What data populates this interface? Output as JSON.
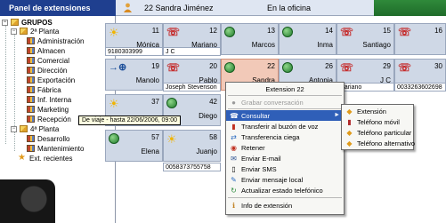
{
  "header": {
    "panel_title": "Panel de extensiones",
    "agent_ext": "22  Sandra Jiménez",
    "agent_status": "En la oficina"
  },
  "tree": {
    "root": "GRUPOS",
    "items": [
      {
        "label": "2ª Planta"
      },
      {
        "label": "Administración"
      },
      {
        "label": "Almacen"
      },
      {
        "label": "Comercial"
      },
      {
        "label": "Dirección"
      },
      {
        "label": "Exportación"
      },
      {
        "label": "Fábrica"
      },
      {
        "label": "Inf. Interna"
      },
      {
        "label": "Marketing"
      },
      {
        "label": "Recepción"
      },
      {
        "label": "4ª Planta"
      },
      {
        "label": "Desarrollo"
      },
      {
        "label": "Mantenimiento"
      },
      {
        "label": "Ext. recientes"
      }
    ]
  },
  "tooltip": "De viaje - hasta 22/06/2006, 09:00",
  "extensions": [
    {
      "num": "11",
      "name": "Mónica",
      "icon": "sun-icon"
    },
    {
      "num": "12",
      "name": "Mariano",
      "icon": "phone-icon"
    },
    {
      "num": "13",
      "name": "Marcos",
      "icon": "available-icon"
    },
    {
      "num": "14",
      "name": "Inma",
      "icon": "available-icon"
    },
    {
      "num": "15",
      "name": "Santiago",
      "icon": "phone-icon"
    },
    {
      "num": "16",
      "name": "",
      "icon": "phone-icon"
    },
    {
      "num": "19",
      "name": "Manolo",
      "icon": "redirect-icon"
    },
    {
      "num": "20",
      "name": "Pablo",
      "icon": "phone-icon"
    },
    {
      "num": "22",
      "name": "Sandra",
      "icon": "available-icon"
    },
    {
      "num": "26",
      "name": "Antonia",
      "icon": "available-icon"
    },
    {
      "num": "29",
      "name": "J C",
      "icon": "phone-icon"
    },
    {
      "num": "30",
      "name": "",
      "icon": "phone-icon"
    },
    {
      "num": "37",
      "name": "",
      "icon": "sun-icon"
    },
    {
      "num": "42",
      "name": "Diego",
      "icon": "available-icon"
    },
    {
      "num": "57",
      "name": "Elena",
      "icon": "available-icon"
    },
    {
      "num": "58",
      "name": "Juanjo",
      "icon": "sun-icon"
    }
  ],
  "info_strips": {
    "r1c1": "9180303999",
    "r1c2": "J C",
    "r2c2": "Joseph Stevenson",
    "r2c5": "Mariano",
    "r2c6": "0033263602698",
    "r4c2": "0058373755758"
  },
  "context_menu": {
    "title": "Extension 22",
    "items": [
      {
        "label": "Grabar conversación",
        "icon": "record-icon",
        "enabled": false
      },
      {
        "label": "Consultar",
        "icon": "consult-icon",
        "enabled": true,
        "submenu": true,
        "highlighted": true
      },
      {
        "label": "Transferir al buzón de voz",
        "icon": "voicemail-icon",
        "enabled": true
      },
      {
        "label": "Transferencia ciega",
        "icon": "transfer-icon",
        "enabled": true
      },
      {
        "label": "Retener",
        "icon": "hold-icon",
        "enabled": true
      },
      {
        "label": "Enviar E-mail",
        "icon": "email-icon",
        "enabled": true
      },
      {
        "label": "Enviar SMS",
        "icon": "sms-icon",
        "enabled": true
      },
      {
        "label": "Enviar mensaje local",
        "icon": "message-icon",
        "enabled": true
      },
      {
        "label": "Actualizar estado telefónico",
        "icon": "refresh-icon",
        "enabled": true
      },
      {
        "label": "Info de extensión",
        "icon": "info-icon",
        "enabled": true
      }
    ]
  },
  "submenu": {
    "items": [
      {
        "label": "Extensión"
      },
      {
        "label": "Teléfono móvil"
      },
      {
        "label": "Teléfono particular"
      },
      {
        "label": "Teléfono alternativo"
      }
    ]
  },
  "colors": {
    "header_blue": "#1f3f8f",
    "cell_bg": "#cfd8e6",
    "selected_cell": "#f2c9b8",
    "menu_highlight": "#2f5fb8",
    "tooltip_bg": "#ffffe1"
  }
}
